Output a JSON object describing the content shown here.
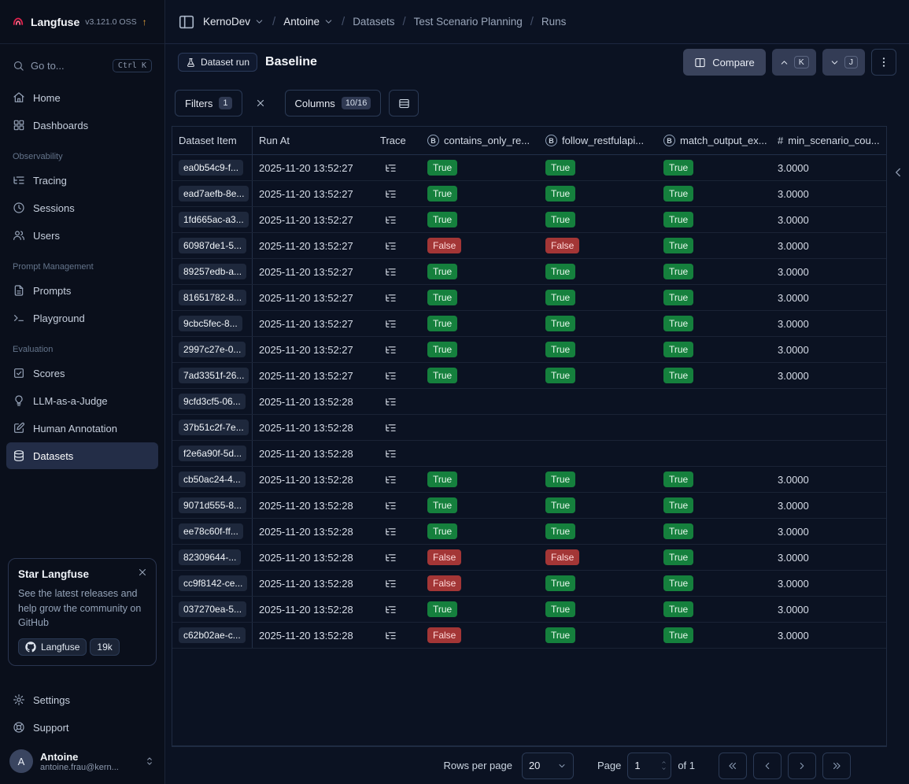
{
  "brand": {
    "name": "Langfuse",
    "version": "v3.121.0 OSS",
    "update_indicator": "↑"
  },
  "sidebar": {
    "goto_label": "Go to...",
    "goto_shortcut": "Ctrl K",
    "sections": {
      "observability": "Observability",
      "prompt_management": "Prompt Management",
      "evaluation": "Evaluation"
    },
    "items": {
      "home": "Home",
      "dashboards": "Dashboards",
      "tracing": "Tracing",
      "sessions": "Sessions",
      "users": "Users",
      "prompts": "Prompts",
      "playground": "Playground",
      "scores": "Scores",
      "llm_judge": "LLM-as-a-Judge",
      "human_annotation": "Human Annotation",
      "datasets": "Datasets",
      "settings": "Settings",
      "support": "Support"
    },
    "promo": {
      "title": "Star Langfuse",
      "body": "See the latest releases and help grow the community on GitHub",
      "github_button": "Langfuse",
      "star_count": "19k"
    },
    "user": {
      "avatar_initial": "A",
      "name": "Antoine",
      "email": "antoine.frau@kern..."
    }
  },
  "breadcrumb": {
    "items": [
      "KernoDev",
      "Antoine",
      "Datasets",
      "Test Scenario Planning",
      "Runs"
    ]
  },
  "header": {
    "badge_label": "Dataset run",
    "title": "Baseline",
    "compare_label": "Compare",
    "prev_key": "K",
    "next_key": "J"
  },
  "toolbar": {
    "filters_label": "Filters",
    "filters_count": "1",
    "columns_label": "Columns",
    "columns_count": "10/16"
  },
  "table": {
    "columns": [
      "Dataset Item",
      "Run At",
      "Trace",
      "contains_only_re...",
      "follow_restfulapi...",
      "match_output_ex...",
      "min_scenario_cou..."
    ],
    "rows": [
      {
        "id": "ea0b54c9-f...",
        "run_at": "2025-11-20 13:52:27",
        "scores": [
          "True",
          "True",
          "True"
        ],
        "min": "3.0000"
      },
      {
        "id": "ead7aefb-8e...",
        "run_at": "2025-11-20 13:52:27",
        "scores": [
          "True",
          "True",
          "True"
        ],
        "min": "3.0000"
      },
      {
        "id": "1fd665ac-a3...",
        "run_at": "2025-11-20 13:52:27",
        "scores": [
          "True",
          "True",
          "True"
        ],
        "min": "3.0000"
      },
      {
        "id": "60987de1-5...",
        "run_at": "2025-11-20 13:52:27",
        "scores": [
          "False",
          "False",
          "True"
        ],
        "min": "3.0000"
      },
      {
        "id": "89257edb-a...",
        "run_at": "2025-11-20 13:52:27",
        "scores": [
          "True",
          "True",
          "True"
        ],
        "min": "3.0000"
      },
      {
        "id": "81651782-8...",
        "run_at": "2025-11-20 13:52:27",
        "scores": [
          "True",
          "True",
          "True"
        ],
        "min": "3.0000"
      },
      {
        "id": "9cbc5fec-8...",
        "run_at": "2025-11-20 13:52:27",
        "scores": [
          "True",
          "True",
          "True"
        ],
        "min": "3.0000"
      },
      {
        "id": "2997c27e-0...",
        "run_at": "2025-11-20 13:52:27",
        "scores": [
          "True",
          "True",
          "True"
        ],
        "min": "3.0000"
      },
      {
        "id": "7ad3351f-26...",
        "run_at": "2025-11-20 13:52:27",
        "scores": [
          "True",
          "True",
          "True"
        ],
        "min": "3.0000"
      },
      {
        "id": "9cfd3cf5-06...",
        "run_at": "2025-11-20 13:52:28",
        "scores": [
          null,
          null,
          null
        ],
        "min": ""
      },
      {
        "id": "37b51c2f-7e...",
        "run_at": "2025-11-20 13:52:28",
        "scores": [
          null,
          null,
          null
        ],
        "min": ""
      },
      {
        "id": "f2e6a90f-5d...",
        "run_at": "2025-11-20 13:52:28",
        "scores": [
          null,
          null,
          null
        ],
        "min": ""
      },
      {
        "id": "cb50ac24-4...",
        "run_at": "2025-11-20 13:52:28",
        "scores": [
          "True",
          "True",
          "True"
        ],
        "min": "3.0000"
      },
      {
        "id": "9071d555-8...",
        "run_at": "2025-11-20 13:52:28",
        "scores": [
          "True",
          "True",
          "True"
        ],
        "min": "3.0000"
      },
      {
        "id": "ee78c60f-ff...",
        "run_at": "2025-11-20 13:52:28",
        "scores": [
          "True",
          "True",
          "True"
        ],
        "min": "3.0000"
      },
      {
        "id": "82309644-...",
        "run_at": "2025-11-20 13:52:28",
        "scores": [
          "False",
          "False",
          "True"
        ],
        "min": "3.0000"
      },
      {
        "id": "cc9f8142-ce...",
        "run_at": "2025-11-20 13:52:28",
        "scores": [
          "False",
          "True",
          "True"
        ],
        "min": "3.0000"
      },
      {
        "id": "037270ea-5...",
        "run_at": "2025-11-20 13:52:28",
        "scores": [
          "True",
          "True",
          "True"
        ],
        "min": "3.0000"
      },
      {
        "id": "c62b02ae-c...",
        "run_at": "2025-11-20 13:52:28",
        "scores": [
          "False",
          "True",
          "True"
        ],
        "min": "3.0000"
      }
    ]
  },
  "footer": {
    "rows_per_page_label": "Rows per page",
    "rows_per_page_value": "20",
    "page_label": "Page",
    "page_value": "1",
    "of_label": "of 1"
  }
}
